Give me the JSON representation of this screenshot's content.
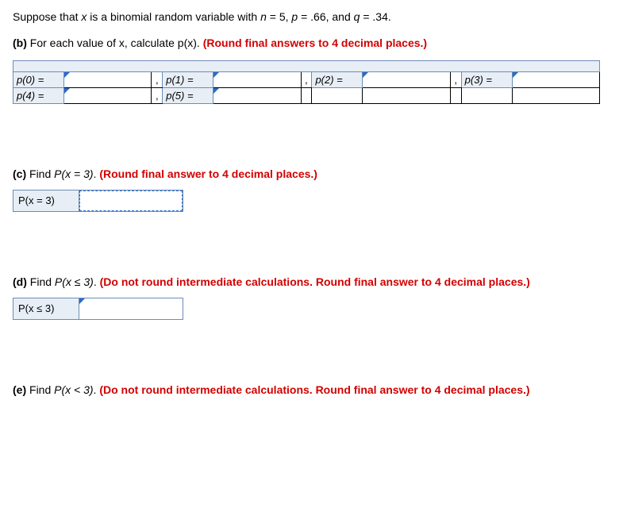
{
  "intro": {
    "prefix": "Suppose that ",
    "x": "x",
    "mid1": " is a binomial random variable with ",
    "n_var": "n",
    "n_eq": " = 5, ",
    "p_var": "p",
    "p_eq": " = .66, and ",
    "q_var": "q",
    "q_eq": " = .34."
  },
  "part_b": {
    "label": "(b)",
    "text_before": " For each value of ",
    "x": "x",
    "text_mid": ", calculate ",
    "px": "p(x)",
    "period": ". ",
    "red": "(Round final answers to 4 decimal places.)",
    "cells": {
      "p0": "p(0) =",
      "p1": "p(1) =",
      "p2": "p(2) =",
      "p3": "p(3) =",
      "p4": "p(4) =",
      "p5": "p(5) ="
    },
    "comma": ","
  },
  "part_c": {
    "label": "(c)",
    "text_before": " Find ",
    "px": "P(x = 3)",
    "period": ". ",
    "red": "(Round final answer to 4 decimal places.)",
    "row_label": "P(x = 3)"
  },
  "part_d": {
    "label": "(d)",
    "text_before": " Find ",
    "px": "P(x ≤ 3)",
    "period": ". ",
    "red": "(Do not round intermediate calculations. Round final answer to 4 decimal places.)",
    "row_label": "P(x ≤ 3)"
  },
  "part_e": {
    "label": "(e)",
    "text_before": " Find ",
    "px": "P(x < 3)",
    "period": ". ",
    "red": "(Do not round intermediate calculations. Round final answer to 4 decimal places.)"
  }
}
